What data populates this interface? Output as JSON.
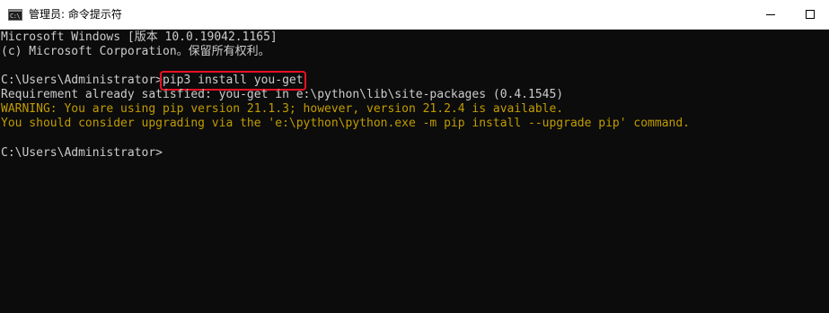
{
  "window": {
    "title": "管理员: 命令提示符",
    "icon": "cmd-icon",
    "icon_glyph": "C:\\"
  },
  "colors": {
    "background": "#0c0c0c",
    "text": "#cccccc",
    "warning": "#c19c00",
    "highlight_box": "#e81123"
  },
  "console": {
    "lines": [
      "Microsoft Windows [版本 10.0.19042.1165]",
      "(c) Microsoft Corporation。保留所有权利。",
      "",
      "",
      "Requirement already satisfied: you-get in e:\\python\\lib\\site-packages (0.4.1545)",
      "WARNING: You are using pip version 21.1.3; however, version 21.2.4 is available.",
      "You should consider upgrading via the 'e:\\python\\python.exe -m pip install --upgrade pip' command.",
      "",
      "C:\\Users\\Administrator>"
    ],
    "prompt": "C:\\Users\\Administrator>",
    "command": "pip3 install you-get"
  }
}
